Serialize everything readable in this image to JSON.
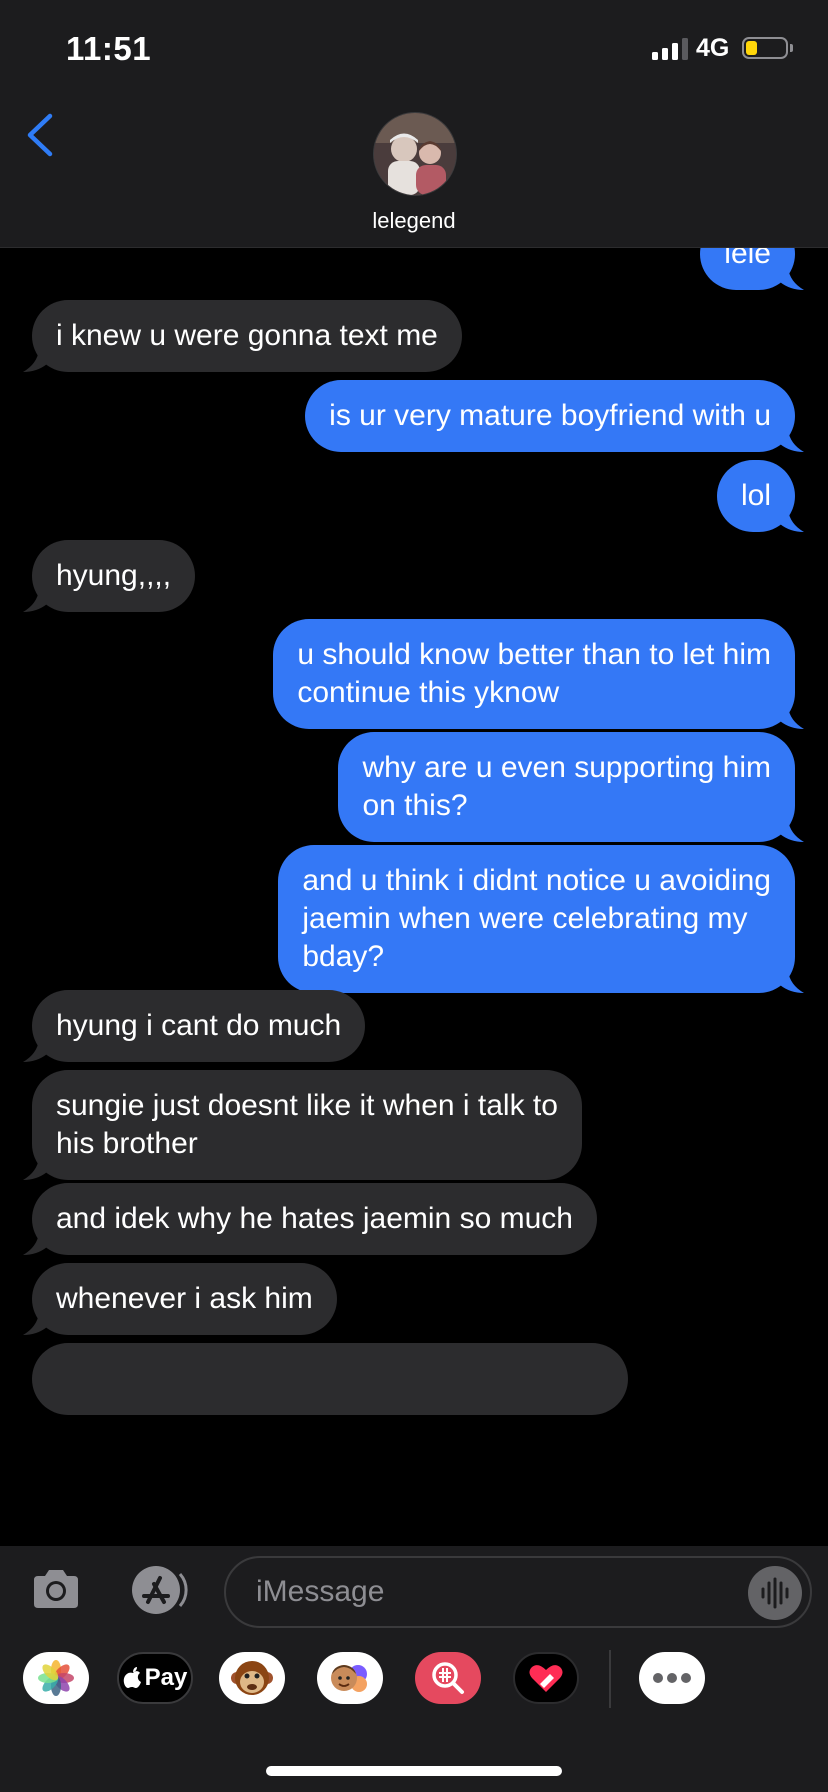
{
  "status_bar": {
    "time": "11:51",
    "network": "4G",
    "battery_level": 0.3
  },
  "header": {
    "contact_name": "lelegend"
  },
  "messages": [
    {
      "from": "me",
      "text": [
        "lele"
      ]
    },
    {
      "from": "them",
      "text": [
        "i knew u were gonna text me"
      ]
    },
    {
      "from": "me",
      "text": [
        "is ur very mature boyfriend with u"
      ]
    },
    {
      "from": "me",
      "text": [
        "lol"
      ]
    },
    {
      "from": "them",
      "text": [
        "hyung,,,,"
      ]
    },
    {
      "from": "me",
      "text": [
        "u should know better than to let him",
        "continue this yknow"
      ]
    },
    {
      "from": "me",
      "text": [
        "why are u even supporting him",
        "on this?"
      ]
    },
    {
      "from": "me",
      "text": [
        "and u think i didnt notice u avoiding",
        "jaemin when were celebrating my",
        "bday?"
      ]
    },
    {
      "from": "them",
      "text": [
        "hyung i cant do much"
      ]
    },
    {
      "from": "them",
      "text": [
        "sungie just doesnt like it when i talk to",
        "his brother"
      ]
    },
    {
      "from": "them",
      "text": [
        "and idek why he hates jaemin so much"
      ]
    },
    {
      "from": "them",
      "text": [
        "whenever i ask him"
      ]
    }
  ],
  "input": {
    "placeholder": "iMessage"
  },
  "app_drawer": {
    "apple_pay_label": "Pay"
  },
  "colors": {
    "sent_bubble": "#3478f6",
    "received_bubble": "#2c2c2e",
    "accent": "#2f7cf6"
  },
  "icons": {
    "back": "chevron-left-icon",
    "camera": "camera-icon",
    "app_store": "app-store-icon",
    "audio": "waveform-icon",
    "photos": "photos-icon",
    "apple_pay": "apple-pay-icon",
    "animoji": "monkey-icon",
    "memoji": "memoji-icon",
    "search": "image-search-icon",
    "heart": "digital-touch-icon",
    "more": "ellipsis-icon"
  }
}
